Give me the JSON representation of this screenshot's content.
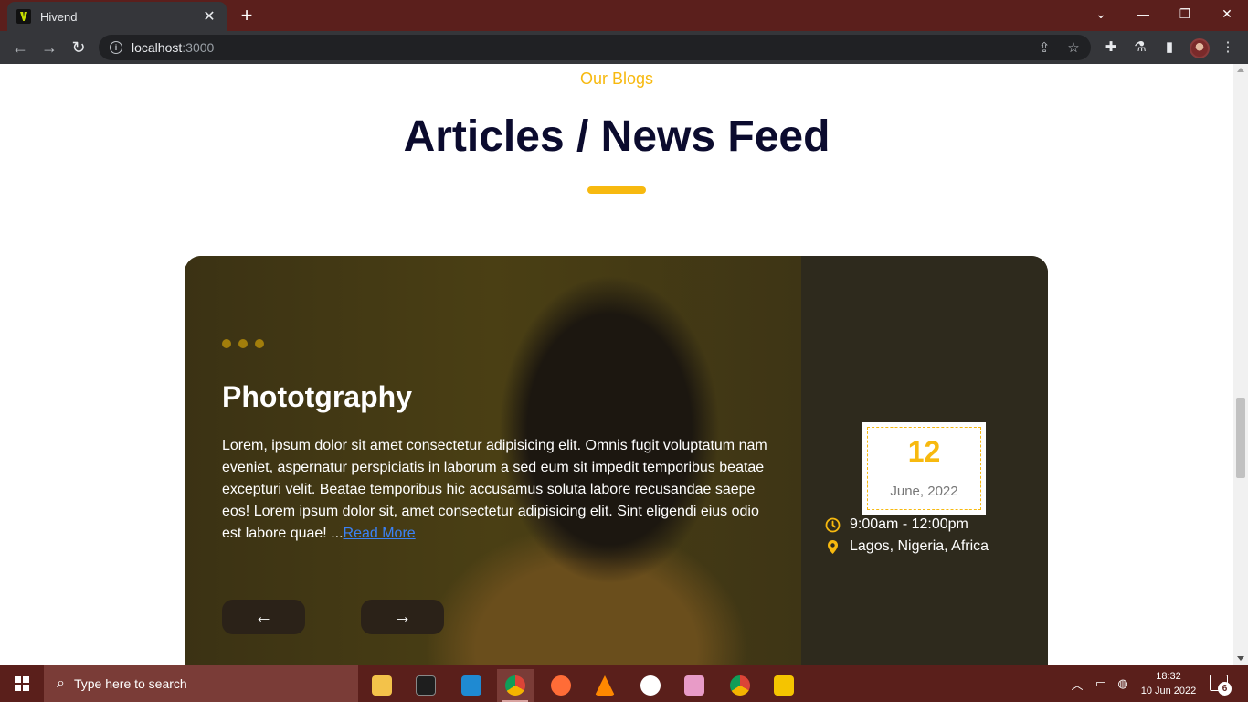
{
  "browser": {
    "tab_title": "Hivend",
    "url_host": "localhost",
    "url_port": ":3000",
    "icons": [
      "back-icon",
      "forward-icon",
      "reload-icon",
      "info-icon",
      "share-icon",
      "star-icon",
      "extensions-icon",
      "labs-icon",
      "side-panel-icon",
      "menu-icon"
    ]
  },
  "section": {
    "eyebrow": "Our Blogs",
    "title": "Articles / News Feed"
  },
  "post": {
    "title": "Phototgraphy",
    "body": "Lorem, ipsum dolor sit amet consectetur adipisicing elit. Omnis fugit voluptatum nam eveniet, aspernatur perspiciatis in laborum a sed eum sit impedit temporibus beatae excepturi velit. Beatae temporibus hic accusamus soluta labore recusandae saepe eos! Lorem ipsum dolor sit, amet consectetur adipisicing elit. Sint eligendi eius odio est labore quae! ...",
    "read_more": "Read More",
    "prev_label": "←",
    "next_label": "→",
    "date_day": "12",
    "date_month": "June, 2022",
    "time": "9:00am - 12:00pm",
    "location": "Lagos, Nigeria, Africa"
  },
  "taskbar": {
    "search_placeholder": "Type here to search",
    "time": "18:32",
    "date": "10 Jun 2022",
    "notification_count": "6"
  },
  "colors": {
    "accent": "#f7b90f",
    "title": "#0b0b2e",
    "chrome": "#5b1f1c",
    "link": "#3b82f6"
  }
}
